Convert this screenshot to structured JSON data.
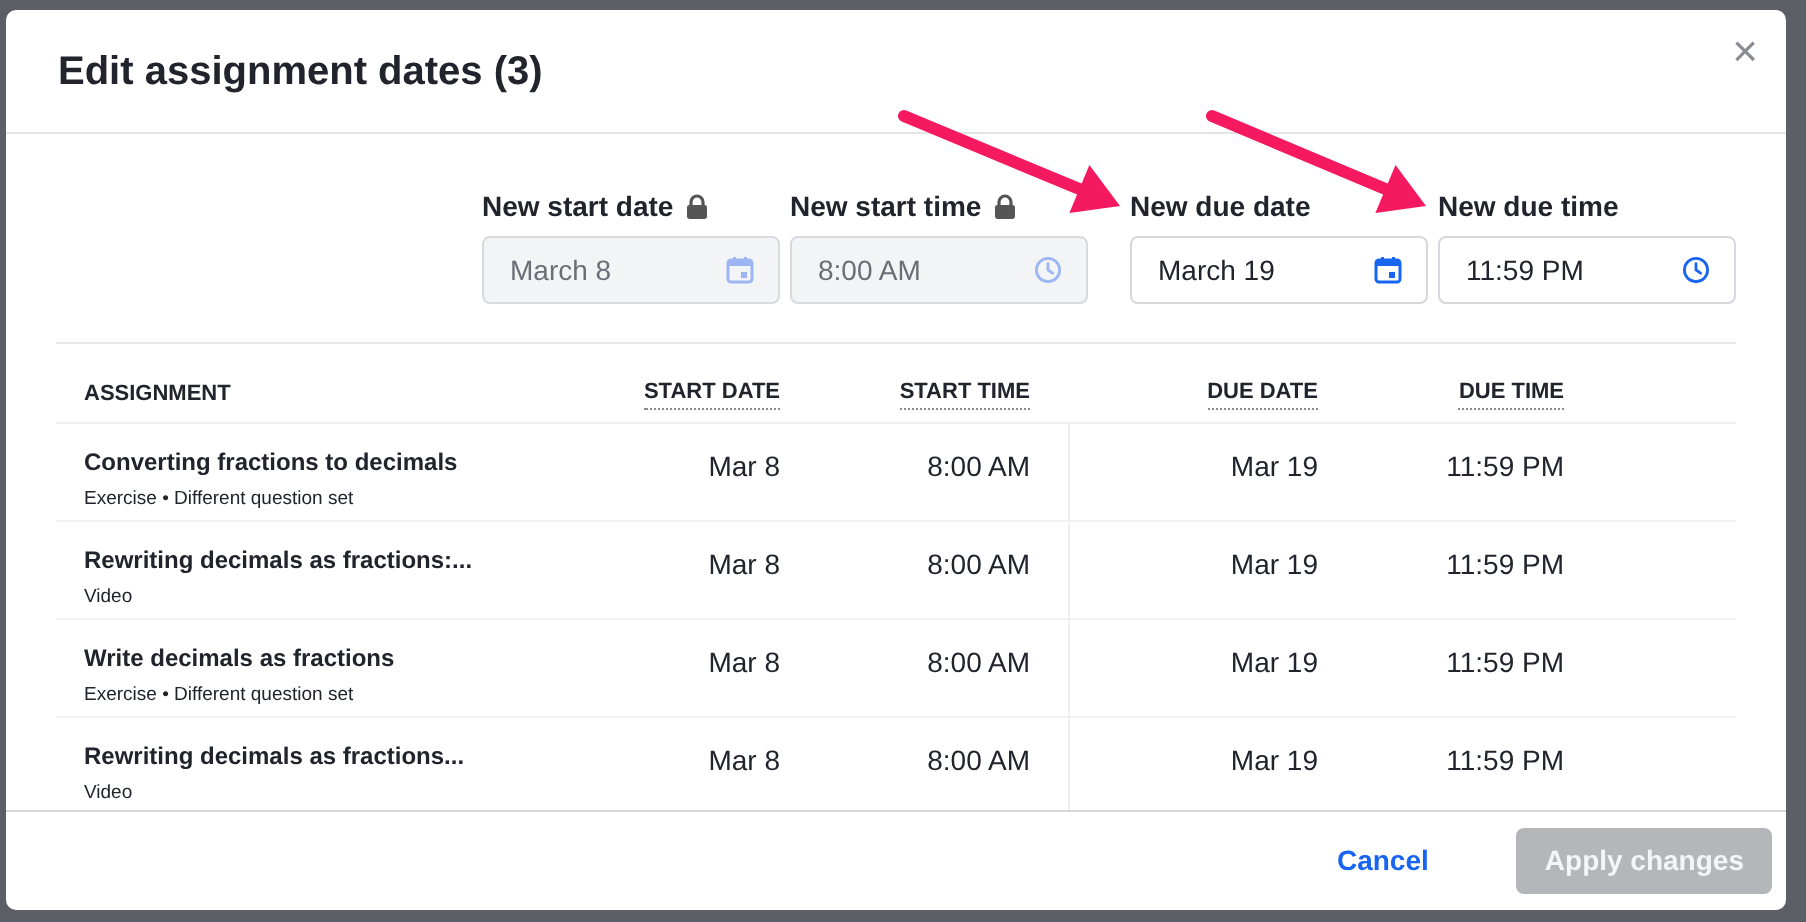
{
  "dialog": {
    "title": "Edit assignment dates (3)",
    "close": "×"
  },
  "fields": [
    {
      "label": "New start date",
      "value": "March 8",
      "kind": "date",
      "disabled": true
    },
    {
      "label": "New start time",
      "value": "8:00 AM",
      "kind": "time",
      "disabled": true
    },
    {
      "label": "New due date",
      "value": "March 19",
      "kind": "date",
      "disabled": false
    },
    {
      "label": "New due time",
      "value": "11:59 PM",
      "kind": "time",
      "disabled": false
    }
  ],
  "table": {
    "columns": [
      "ASSIGNMENT",
      "START DATE",
      "START TIME",
      "DUE DATE",
      "DUE TIME"
    ],
    "rows": [
      {
        "title": "Converting fractions to decimals",
        "subtitle": "Exercise • Different question set",
        "start_date": "Mar 8",
        "start_time": "8:00 AM",
        "due_date": "Mar 19",
        "due_time": "11:59 PM"
      },
      {
        "title": "Rewriting decimals as fractions:...",
        "subtitle": "Video",
        "start_date": "Mar 8",
        "start_time": "8:00 AM",
        "due_date": "Mar 19",
        "due_time": "11:59 PM"
      },
      {
        "title": "Write decimals as fractions",
        "subtitle": "Exercise • Different question set",
        "start_date": "Mar 8",
        "start_time": "8:00 AM",
        "due_date": "Mar 19",
        "due_time": "11:59 PM"
      },
      {
        "title": "Rewriting decimals as fractions...",
        "subtitle": "Video",
        "start_date": "Mar 8",
        "start_time": "8:00 AM",
        "due_date": "Mar 19",
        "due_time": "11:59 PM"
      }
    ]
  },
  "footer": {
    "cancel": "Cancel",
    "apply": {
      "label": "Apply changes",
      "disabled": true
    }
  }
}
